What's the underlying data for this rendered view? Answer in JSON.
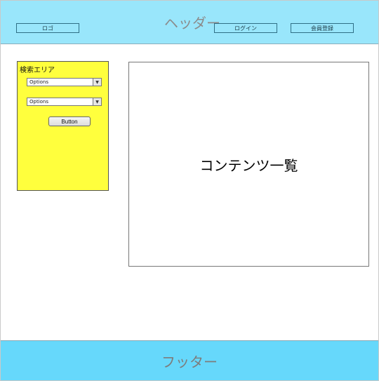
{
  "header": {
    "title": "ヘッダー",
    "logo_label": "ロゴ",
    "login_label": "ログイン",
    "register_label": "会員登録"
  },
  "search": {
    "title": "検索エリア",
    "select_1": {
      "value": "Options",
      "arrow": "▼"
    },
    "select_2": {
      "value": "Options",
      "arrow": "▼"
    },
    "button_label": "Button"
  },
  "content": {
    "title": "コンテンツ一覧"
  },
  "footer": {
    "title": "フッター"
  },
  "colors": {
    "header_bg": "#99e6fb",
    "search_bg": "#ffff3d",
    "footer_bg": "#66d8fb"
  }
}
